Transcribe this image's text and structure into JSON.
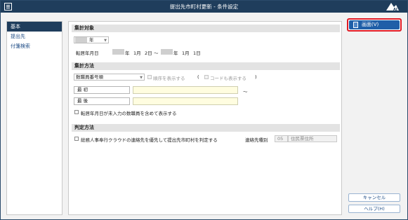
{
  "window": {
    "title": "提出先市町村更新 - 条件設定"
  },
  "sidebar": {
    "items": [
      {
        "label": "基本",
        "active": true
      },
      {
        "label": "提出先",
        "active": false
      },
      {
        "label": "付箋検索",
        "active": false
      }
    ]
  },
  "sections": {
    "aggregation_target": {
      "title": "集計対象",
      "unit_select": "年",
      "date_label": "転居年月日",
      "from": {
        "year_unit": "年",
        "month": "1月",
        "day": "2日"
      },
      "tilde": "～",
      "to": {
        "year_unit": "年",
        "month": "1月",
        "day": "1日"
      }
    },
    "aggregation_method": {
      "title": "集計方法",
      "order_select": "数職員番号順",
      "show_order_label": "順序を表示する",
      "show_code_label": "コードも表示する",
      "paren_open": "(",
      "paren_close": ")",
      "first_label": "最 初",
      "last_label": "最 後",
      "range_tilde": "～",
      "include_label": "転居年月日が未入力の数職員を含めて表示する"
    },
    "judgement_method": {
      "title": "判定方法",
      "checkbox_label": "総務人事奉行クラウドの連絡先を優先して提出先市町村を判定する",
      "contact_type_label": "連絡先種別",
      "contact_code": "05",
      "contact_name": "住民票住所"
    }
  },
  "right_panel": {
    "display_button": "画面(V)",
    "cancel_button": "キャンセル",
    "help_button": "ヘルプ(H)"
  },
  "colors": {
    "titlebar": "#1f3d5c",
    "primary_button": "#1f5fa8",
    "highlight_border": "#e01a24",
    "input_yellow": "#fffde0"
  }
}
